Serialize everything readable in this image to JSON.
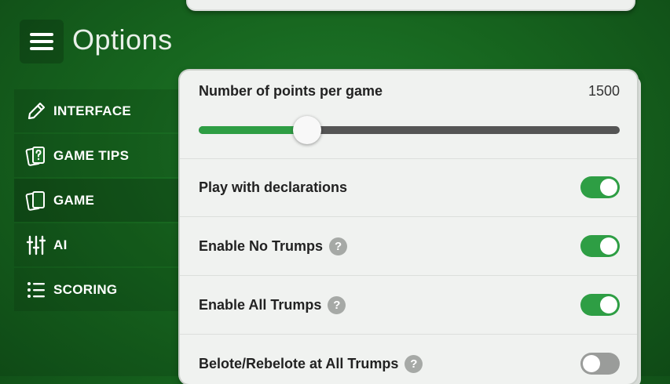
{
  "header": {
    "title": "Options"
  },
  "sidebar": {
    "items": [
      {
        "label": "INTERFACE",
        "icon": "pencil-icon"
      },
      {
        "label": "GAME TIPS",
        "icon": "card-question-icon"
      },
      {
        "label": "GAME",
        "icon": "cards-icon",
        "active": true
      },
      {
        "label": "AI",
        "icon": "sliders-icon"
      },
      {
        "label": "SCORING",
        "icon": "list-icon"
      }
    ]
  },
  "settings": {
    "points": {
      "label": "Number of points per game",
      "value": "1500",
      "slider_fraction": 0.258
    },
    "declarations": {
      "label": "Play with declarations",
      "on": true
    },
    "no_trumps": {
      "label": "Enable No Trumps",
      "help": "?",
      "on": true
    },
    "all_trumps": {
      "label": "Enable All Trumps",
      "help": "?",
      "on": true
    },
    "belote": {
      "label": "Belote/Rebelote at All Trumps",
      "help": "?",
      "on": false
    }
  },
  "colors": {
    "accent": "#2e9e44",
    "background": "#17661f",
    "card": "#f0f2f0"
  }
}
